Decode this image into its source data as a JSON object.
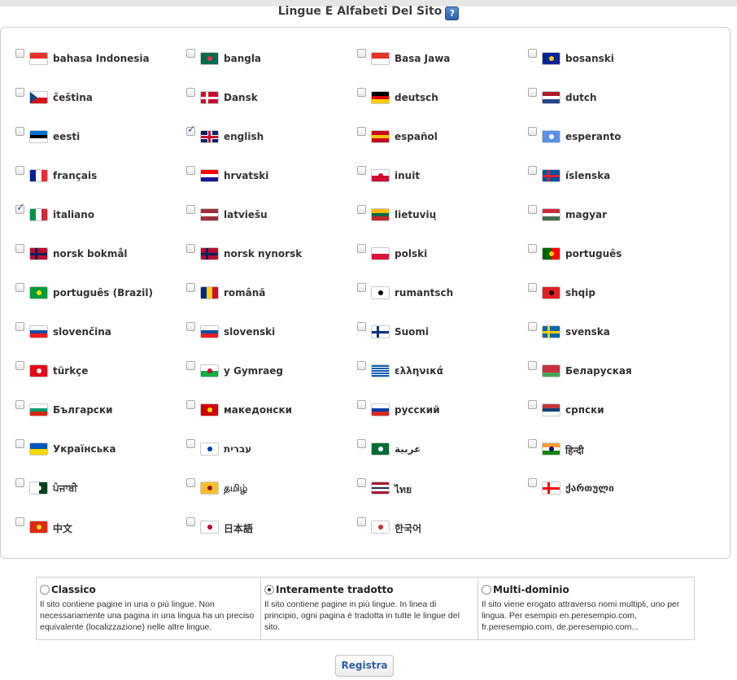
{
  "header": {
    "title": "Lingue E Alfabeti Del Sito",
    "help_icon": "?"
  },
  "languages": [
    {
      "label": "bahasa Indonesia",
      "checked": false,
      "flag": {
        "type": "h",
        "colors": [
          "#e4312b",
          "#ffffff"
        ]
      }
    },
    {
      "label": "bangla",
      "checked": false,
      "flag": {
        "type": "solid",
        "colors": [
          "#006a4e"
        ],
        "dot": "#f42a41"
      }
    },
    {
      "label": "Basa Jawa",
      "checked": false,
      "flag": {
        "type": "h",
        "colors": [
          "#e4312b",
          "#ffffff"
        ]
      }
    },
    {
      "label": "bosanski",
      "checked": false,
      "flag": {
        "type": "solid",
        "colors": [
          "#002395"
        ],
        "dot": "#fecb00"
      }
    },
    {
      "label": "čeština",
      "checked": false,
      "flag": {
        "type": "h",
        "colors": [
          "#ffffff",
          "#d7141a"
        ],
        "tri": "#11457e"
      }
    },
    {
      "label": "Dansk",
      "checked": false,
      "flag": {
        "type": "solid",
        "colors": [
          "#c60c30"
        ],
        "cross": "#ffffff"
      }
    },
    {
      "label": "deutsch",
      "checked": false,
      "flag": {
        "type": "h",
        "colors": [
          "#000000",
          "#dd0000",
          "#ffce00"
        ]
      }
    },
    {
      "label": "dutch",
      "checked": false,
      "flag": {
        "type": "h",
        "colors": [
          "#ae1c28",
          "#ffffff",
          "#21468b"
        ]
      }
    },
    {
      "label": "eesti",
      "checked": false,
      "flag": {
        "type": "h",
        "colors": [
          "#0072ce",
          "#000000",
          "#ffffff"
        ]
      }
    },
    {
      "label": "english",
      "checked": true,
      "flag": {
        "type": "uk",
        "colors": [
          "#012169",
          "#ffffff",
          "#c8102e"
        ]
      }
    },
    {
      "label": "español",
      "checked": false,
      "flag": {
        "type": "h3",
        "colors": [
          "#c60b1e",
          "#ffc400",
          "#c60b1e"
        ]
      }
    },
    {
      "label": "esperanto",
      "checked": false,
      "flag": {
        "type": "solid",
        "colors": [
          "#5b92e5"
        ],
        "dot": "#ffffff"
      }
    },
    {
      "label": "français",
      "checked": false,
      "flag": {
        "type": "v",
        "colors": [
          "#002395",
          "#ffffff",
          "#ed2939"
        ]
      }
    },
    {
      "label": "hrvatski",
      "checked": false,
      "flag": {
        "type": "h",
        "colors": [
          "#ff0000",
          "#ffffff",
          "#171796"
        ]
      }
    },
    {
      "label": "inuit",
      "checked": false,
      "flag": {
        "type": "h",
        "colors": [
          "#ffffff",
          "#d00c33"
        ],
        "dot": "#d00c33"
      }
    },
    {
      "label": "íslenska",
      "checked": false,
      "flag": {
        "type": "solid",
        "colors": [
          "#02529c"
        ],
        "cross": "#dc1e35"
      }
    },
    {
      "label": "italiano",
      "checked": true,
      "flag": {
        "type": "v",
        "colors": [
          "#009246",
          "#ffffff",
          "#ce2b37"
        ]
      }
    },
    {
      "label": "latviešu",
      "checked": false,
      "flag": {
        "type": "h3",
        "colors": [
          "#9e3039",
          "#ffffff",
          "#9e3039"
        ]
      }
    },
    {
      "label": "lietuvių",
      "checked": false,
      "flag": {
        "type": "h",
        "colors": [
          "#fdb913",
          "#006a44",
          "#c1272d"
        ]
      }
    },
    {
      "label": "magyar",
      "checked": false,
      "flag": {
        "type": "h",
        "colors": [
          "#cd2a3e",
          "#ffffff",
          "#436f4d"
        ]
      }
    },
    {
      "label": "norsk bokmål",
      "checked": false,
      "flag": {
        "type": "solid",
        "colors": [
          "#ba0c2f"
        ],
        "cross": "#00205b"
      }
    },
    {
      "label": "norsk nynorsk",
      "checked": false,
      "flag": {
        "type": "solid",
        "colors": [
          "#ba0c2f"
        ],
        "cross": "#00205b"
      }
    },
    {
      "label": "polski",
      "checked": false,
      "flag": {
        "type": "h",
        "colors": [
          "#ffffff",
          "#dc143c"
        ]
      }
    },
    {
      "label": "português",
      "checked": false,
      "flag": {
        "type": "v2",
        "colors": [
          "#006600",
          "#ff0000"
        ],
        "dot": "#ffcc00"
      }
    },
    {
      "label": "português (Brazil)",
      "checked": false,
      "flag": {
        "type": "solid",
        "colors": [
          "#009c3b"
        ],
        "dot": "#ffdf00"
      }
    },
    {
      "label": "română",
      "checked": false,
      "flag": {
        "type": "v",
        "colors": [
          "#002b7f",
          "#fcd116",
          "#ce1126"
        ]
      }
    },
    {
      "label": "rumantsch",
      "checked": false,
      "flag": {
        "type": "solid",
        "colors": [
          "#ffffff"
        ],
        "dot": "#000000"
      }
    },
    {
      "label": "shqip",
      "checked": false,
      "flag": {
        "type": "solid",
        "colors": [
          "#e41e20"
        ],
        "dot": "#000000"
      }
    },
    {
      "label": "slovenčina",
      "checked": false,
      "flag": {
        "type": "h",
        "colors": [
          "#ffffff",
          "#0b4ea2",
          "#ee1c25"
        ]
      }
    },
    {
      "label": "slovenski",
      "checked": false,
      "flag": {
        "type": "h",
        "colors": [
          "#ffffff",
          "#0b4ea2",
          "#ee1c25"
        ]
      }
    },
    {
      "label": "Suomi",
      "checked": false,
      "flag": {
        "type": "solid",
        "colors": [
          "#ffffff"
        ],
        "cross": "#003580"
      }
    },
    {
      "label": "svenska",
      "checked": false,
      "flag": {
        "type": "solid",
        "colors": [
          "#006aa7"
        ],
        "cross": "#fecc00"
      }
    },
    {
      "label": "türkçe",
      "checked": false,
      "flag": {
        "type": "solid",
        "colors": [
          "#e30a17"
        ],
        "dot": "#ffffff"
      }
    },
    {
      "label": "y Gymraeg",
      "checked": false,
      "flag": {
        "type": "h",
        "colors": [
          "#ffffff",
          "#00b140"
        ],
        "dot": "#d30731"
      }
    },
    {
      "label": "ελληνικά",
      "checked": false,
      "flag": {
        "type": "stripes",
        "colors": [
          "#0d5eaf",
          "#ffffff"
        ]
      }
    },
    {
      "label": "Беларуская",
      "checked": false,
      "flag": {
        "type": "h2b",
        "colors": [
          "#c8313e",
          "#4aa657"
        ]
      }
    },
    {
      "label": "Български",
      "checked": false,
      "flag": {
        "type": "h",
        "colors": [
          "#ffffff",
          "#00966e",
          "#d62612"
        ]
      }
    },
    {
      "label": "македонски",
      "checked": false,
      "flag": {
        "type": "solid",
        "colors": [
          "#d20000"
        ],
        "dot": "#ffe600"
      }
    },
    {
      "label": "русский",
      "checked": false,
      "flag": {
        "type": "h",
        "colors": [
          "#ffffff",
          "#0039a6",
          "#d52b1e"
        ]
      }
    },
    {
      "label": "српски",
      "checked": false,
      "flag": {
        "type": "h",
        "colors": [
          "#c6363c",
          "#0c4076",
          "#ffffff"
        ]
      }
    },
    {
      "label": "Українська",
      "checked": false,
      "flag": {
        "type": "h",
        "colors": [
          "#0057b7",
          "#ffd700"
        ]
      }
    },
    {
      "label": "עברית",
      "checked": false,
      "flag": {
        "type": "h3",
        "colors": [
          "#ffffff",
          "#ffffff",
          "#ffffff"
        ],
        "dot": "#0038b8"
      }
    },
    {
      "label": "عربية",
      "checked": false,
      "flag": {
        "type": "solid",
        "colors": [
          "#006c35"
        ],
        "dot": "#ffffff"
      }
    },
    {
      "label": "हिन्दी",
      "checked": false,
      "flag": {
        "type": "h",
        "colors": [
          "#ff9933",
          "#ffffff",
          "#138808"
        ],
        "dot": "#000080"
      }
    },
    {
      "label": "ਪੰਜਾਬੀ",
      "checked": false,
      "flag": {
        "type": "v2",
        "colors": [
          "#ffffff",
          "#01411c"
        ],
        "dot": "#ffffff"
      }
    },
    {
      "label": "தமிழ்",
      "checked": false,
      "flag": {
        "type": "solid",
        "colors": [
          "#ffbe29"
        ],
        "dot": "#8d153a"
      }
    },
    {
      "label": "ไทย",
      "checked": false,
      "flag": {
        "type": "h5",
        "colors": [
          "#a51931",
          "#f4f5f8",
          "#2d2a4a",
          "#f4f5f8",
          "#a51931"
        ]
      }
    },
    {
      "label": "ქართული",
      "checked": false,
      "flag": {
        "type": "solid",
        "colors": [
          "#ffffff"
        ],
        "cross": "#ff0000"
      }
    },
    {
      "label": "中文",
      "checked": false,
      "flag": {
        "type": "solid",
        "colors": [
          "#de2910"
        ],
        "dot": "#ffde00"
      }
    },
    {
      "label": "日本語",
      "checked": false,
      "flag": {
        "type": "solid",
        "colors": [
          "#ffffff"
        ],
        "dot": "#bc002d"
      }
    },
    {
      "label": "한국어",
      "checked": false,
      "flag": {
        "type": "solid",
        "colors": [
          "#ffffff"
        ],
        "dot": "#cd2e3a"
      }
    }
  ],
  "modes": [
    {
      "label": "Classico",
      "selected": false,
      "description": "Il sito contiene pagine in una o più lingue. Non necessariamente una pagina in una lingua ha un preciso equivalente (localizzazione) nelle altre lingue."
    },
    {
      "label": "Interamente tradotto",
      "selected": true,
      "description": "Il sito contiene pagine in più lingue. In linea di principio, ogni pagina è tradotta in tutte le lingue del sito."
    },
    {
      "label": "Multi-dominio",
      "selected": false,
      "description": "Il sito viene erogato attraverso nomi multipli, uno per lingua. Per esempio en.peresempio.com, fr.peresempio.com, de.peresempio.com..."
    }
  ],
  "actions": {
    "save_label": "Registra"
  }
}
